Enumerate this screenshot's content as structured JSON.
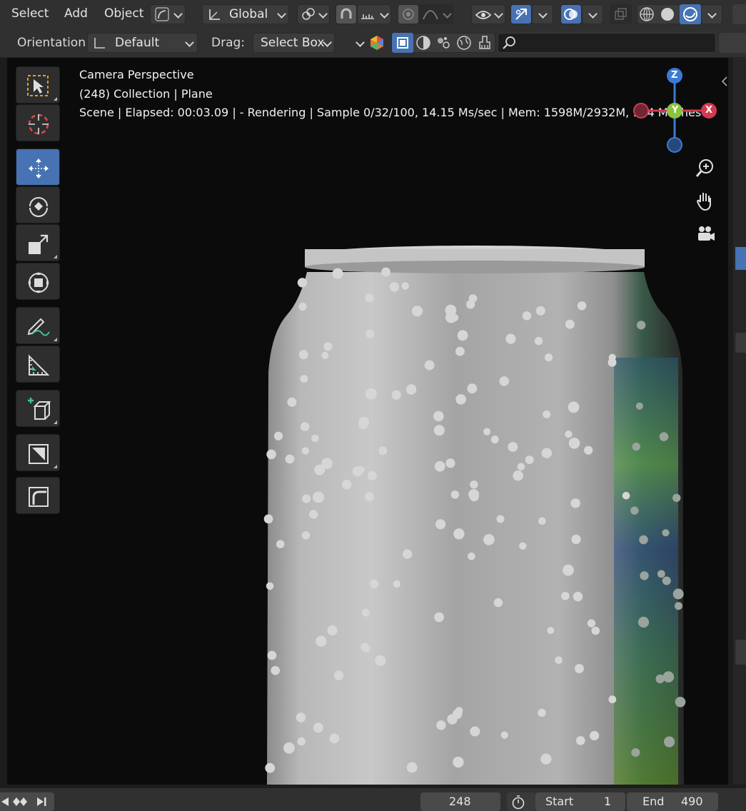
{
  "header": {
    "menus": [
      "Select",
      "Add",
      "Object"
    ],
    "transform_space": "Global",
    "orientation_label": "Orientation:",
    "orientation_value": "Default",
    "drag_label": "Drag:",
    "drag_value": "Select Box",
    "search_placeholder": ""
  },
  "overlay": {
    "view_name": "Camera Perspective",
    "collection_line": "(248) Collection | Plane",
    "status_line": "Scene | Elapsed: 00:03.09 |  - Rendering | Sample 0/32/100, 14.15 Ms/sec | Mem: 1598M/2932M, 144 Meshes"
  },
  "gizmo": {
    "z_label": "Z",
    "y_label": "Y",
    "x_label": "X"
  },
  "toolbar": {
    "tools": [
      "select-box",
      "cursor",
      "move",
      "rotate",
      "scale",
      "transform",
      "annotate",
      "measure",
      "add-cube",
      "extrude",
      "bevel"
    ],
    "active": "move"
  },
  "timeline": {
    "current_frame": "248",
    "start_label": "Start",
    "start_value": "1",
    "end_label": "End",
    "end_value": "490"
  },
  "colors": {
    "accent": "#4772b3",
    "axis_x": "#d33a4f",
    "axis_y": "#8bc53f",
    "axis_z": "#3b7bd2"
  }
}
